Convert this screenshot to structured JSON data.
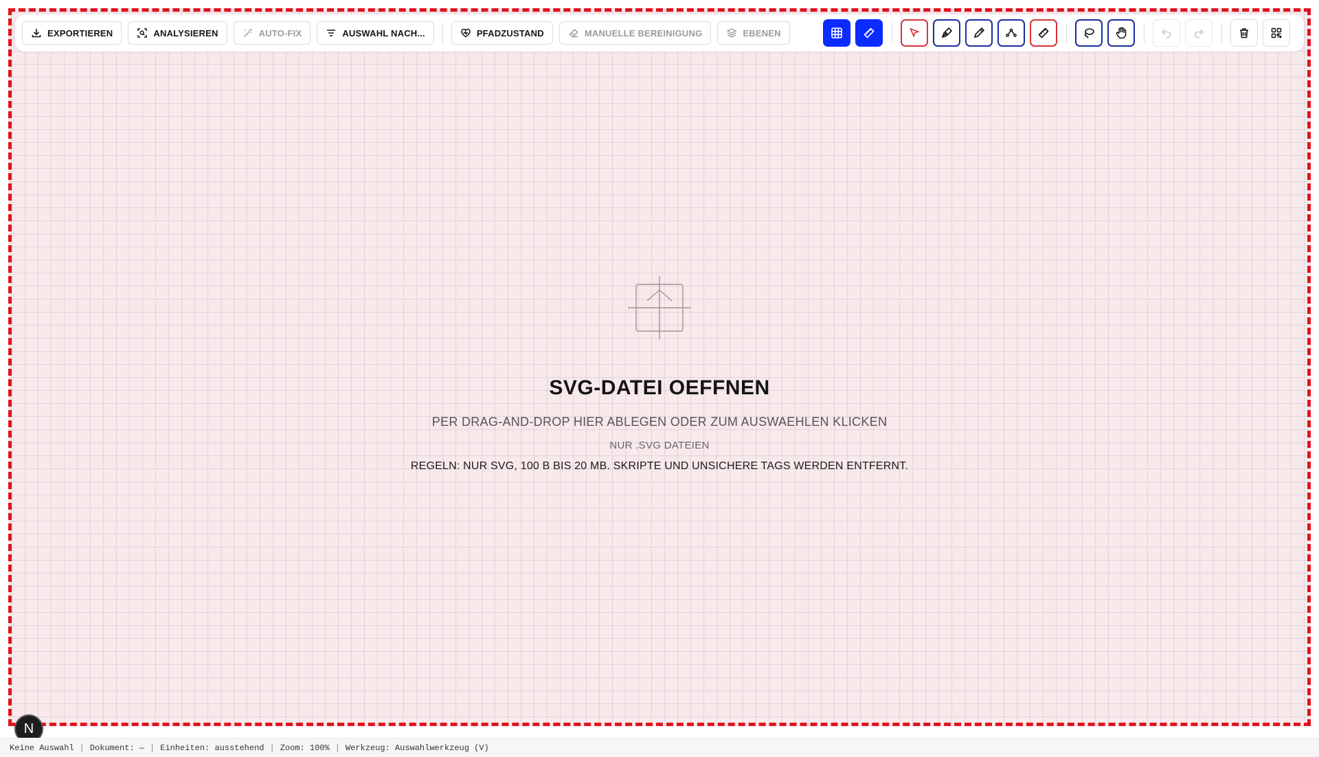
{
  "toolbar": {
    "export_label": "EXPORTIEREN",
    "analyze_label": "ANALYSIEREN",
    "autofix_label": "AUTO-FIX",
    "select_by_label": "AUSWAHL NACH...",
    "path_health_label": "PFADZUSTAND",
    "manual_cleanup_label": "MANUELLE BEREINIGUNG",
    "layers_label": "EBENEN"
  },
  "drop_zone": {
    "title": "SVG-DATEI OEFFNEN",
    "subtitle": "PER DRAG-AND-DROP HIER ABLEGEN ODER ZUM AUSWAEHLEN KLICKEN",
    "note": "NUR .SVG DATEIEN",
    "rules": "REGELN: NUR SVG, 100 B BIS 20 MB. SKRIPTE UND UNSICHERE TAGS WERDEN ENTFERNT."
  },
  "avatar": {
    "letter": "N"
  },
  "status": {
    "selection": "Keine Auswahl",
    "document": "Dokument: —",
    "units": "Einheiten: ausstehend",
    "zoom": "Zoom: 100%",
    "tool": "Werkzeug: Auswahlwerkzeug (V)",
    "divider": "|"
  },
  "colors": {
    "accent_blue": "#0b2bff",
    "danger_red": "#e0141e",
    "canvas_bg": "#f8e9ea"
  }
}
